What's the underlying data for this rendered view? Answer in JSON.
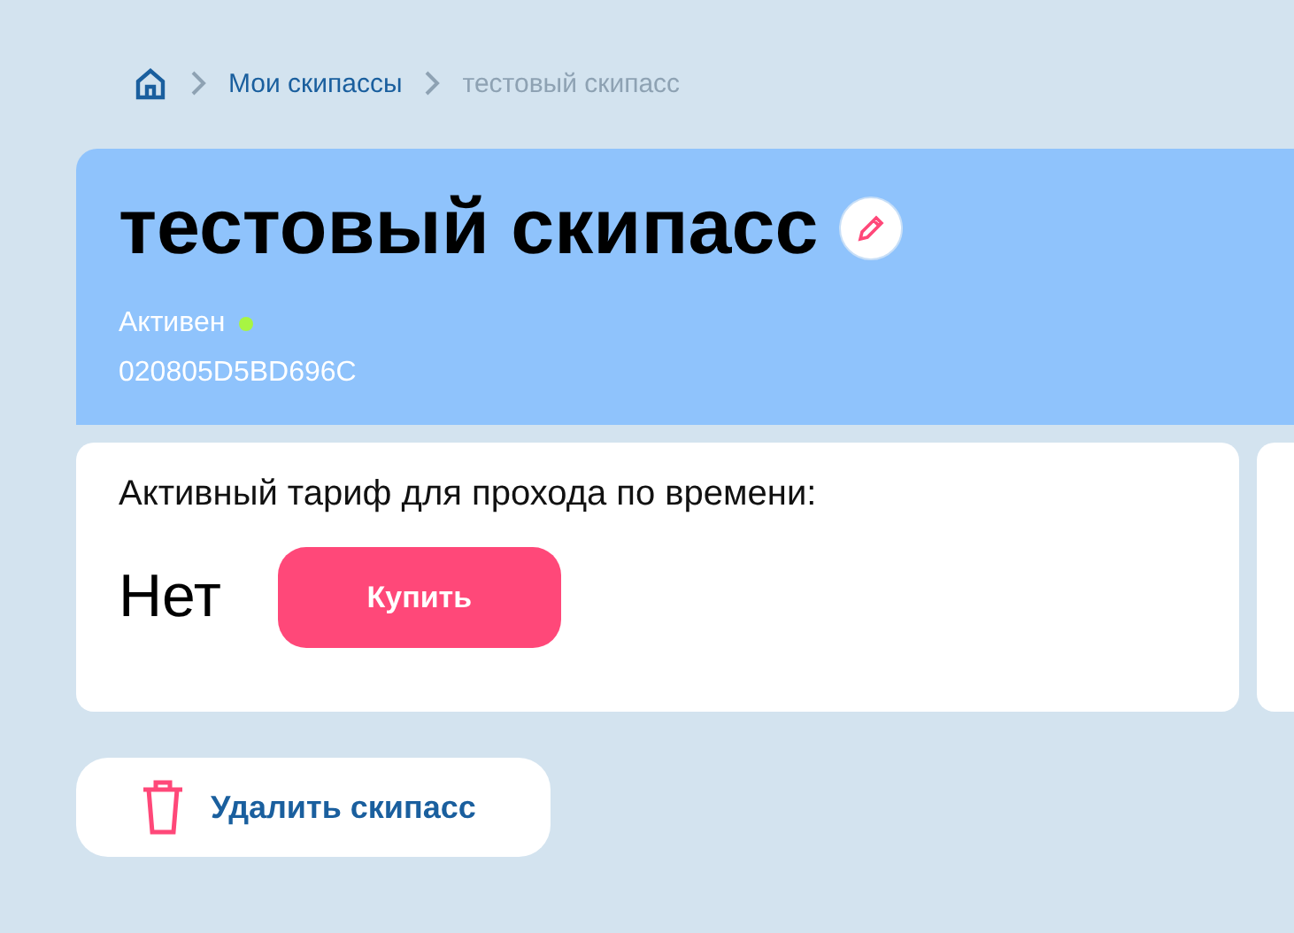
{
  "breadcrumbs": [
    {
      "label": "Мои скипассы",
      "current": false
    },
    {
      "label": "тестовый скипасс",
      "current": true
    }
  ],
  "header": {
    "title": "тестовый скипасс",
    "status": {
      "label": "Активен",
      "color": "#a8f542"
    },
    "code": "020805D5BD696C"
  },
  "tariff_card": {
    "title": "Активный тариф для прохода по времени:",
    "value": "Нет",
    "button": "Купить"
  },
  "delete_button": "Удалить скипасс"
}
